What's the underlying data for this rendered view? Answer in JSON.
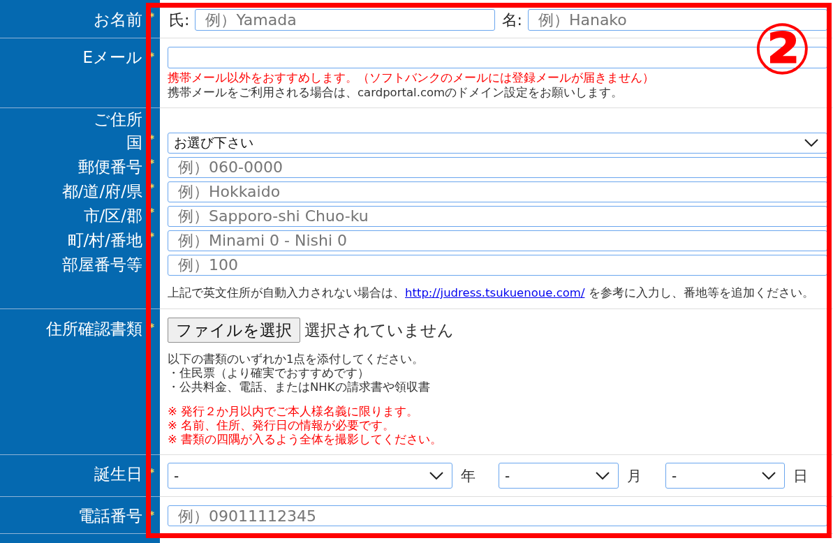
{
  "annotation": {
    "number": "②"
  },
  "rows": [
    {
      "kind": "name",
      "label": "お名前",
      "required": true,
      "fields": [
        {
          "prefix": "氏:",
          "placeholder": "例）Yamada"
        },
        {
          "prefix": "名:",
          "placeholder": "例）Hanako"
        }
      ]
    },
    {
      "kind": "email",
      "label": "Eメール",
      "required": true,
      "notes": [
        {
          "kind": "warning",
          "lines": [
            "携帯メール以外をおすすめします。（ソフトバンクのメールには登録メールが届きません）"
          ]
        },
        {
          "kind": "info",
          "lines": [
            "携帯メールをご利用される場合は、cardportal.comのドメイン設定をお願いします。"
          ]
        }
      ]
    },
    {
      "kind": "address",
      "label": "ご住所",
      "required": false,
      "fields": [
        {
          "kind": "select",
          "label": "国",
          "required": true,
          "value": "お選び下さい"
        },
        {
          "kind": "input",
          "label": "郵便番号",
          "required": true,
          "placeholder": "例）060-0000"
        },
        {
          "kind": "input",
          "label": "都/道/府/県",
          "required": true,
          "placeholder": "例）Hokkaido"
        },
        {
          "kind": "input",
          "label": "市/区/郡",
          "required": true,
          "placeholder": "例）Sapporo-shi Chuo-ku"
        },
        {
          "kind": "input",
          "label": "町/村/番地",
          "required": true,
          "placeholder": "例）Minami 0 - Nishi 0"
        },
        {
          "kind": "input",
          "label": "部屋番号等",
          "required": false,
          "placeholder": "例）100"
        }
      ],
      "note": {
        "before": "上記で英文住所が自動入力されない場合は、",
        "link": "http://judress.tsukuenoue.com/",
        "after": " を参考に入力し、番地等を追加ください。"
      }
    },
    {
      "kind": "document",
      "label": "住所確認書類",
      "required": true,
      "file_button": "ファイルを選択",
      "file_status": "選択されていません",
      "notes": [
        {
          "kind": "info",
          "lines": [
            "以下の書類のいずれか1点を添付してください。",
            "・住民票（より確実でおすすめです）",
            "・公共料金、電話、またはNHKの請求書や領収書"
          ]
        },
        {
          "kind": "warning",
          "lines": [
            "※ 発行２か月以内でご本人様名義に限ります。",
            "※ 名前、住所、発行日の情報が必要です。",
            "※ 書類の四隅が入るよう全体を撮影してください。"
          ]
        }
      ]
    },
    {
      "kind": "birthday",
      "label": "誕生日",
      "required": true,
      "selects": [
        {
          "value": "-",
          "unit": "年"
        },
        {
          "value": "-",
          "unit": "月"
        },
        {
          "value": "-",
          "unit": "日"
        }
      ]
    },
    {
      "kind": "phone",
      "label": "電話番号",
      "required": true,
      "placeholder": "例）09011112345"
    }
  ]
}
